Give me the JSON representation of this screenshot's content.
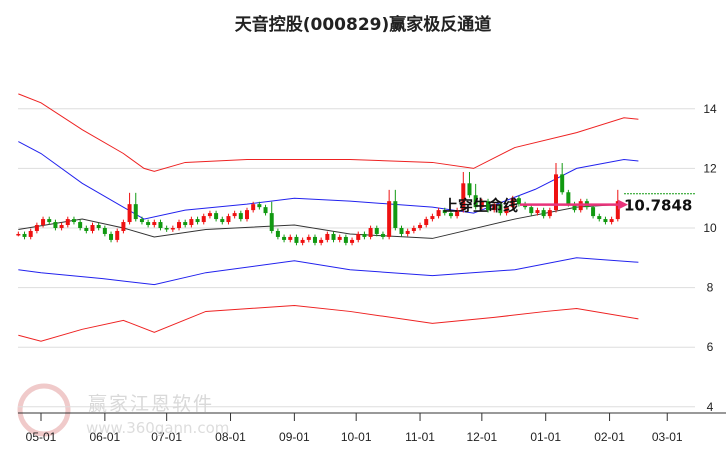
{
  "chart_data": {
    "type": "line",
    "title": "天音控股(000829)赢家极反通道",
    "ylim": [
      4,
      15
    ],
    "y_ticks": [
      4,
      6,
      8,
      10,
      12,
      14
    ],
    "x_ticks": [
      {
        "label": "05-01",
        "day": 0
      },
      {
        "label": "06-01",
        "day": 31
      },
      {
        "label": "07-01",
        "day": 61
      },
      {
        "label": "08-01",
        "day": 92
      },
      {
        "label": "09-01",
        "day": 123
      },
      {
        "label": "10-01",
        "day": 153
      },
      {
        "label": "11-01",
        "day": 184
      },
      {
        "label": "12-01",
        "day": 214
      },
      {
        "label": "01-01",
        "day": 245
      },
      {
        "label": "02-01",
        "day": 276
      },
      {
        "label": "03-01",
        "day": 304
      }
    ],
    "series": [
      {
        "name": "upper-outer",
        "color": "#ee2222",
        "points": [
          [
            -11,
            14.5
          ],
          [
            0,
            14.2
          ],
          [
            20,
            13.3
          ],
          [
            40,
            12.5
          ],
          [
            50,
            12.0
          ],
          [
            55,
            11.9
          ],
          [
            70,
            12.2
          ],
          [
            100,
            12.3
          ],
          [
            150,
            12.3
          ],
          [
            190,
            12.2
          ],
          [
            210,
            12.0
          ],
          [
            230,
            12.7
          ],
          [
            260,
            13.2
          ],
          [
            283,
            13.7
          ],
          [
            290,
            13.65
          ]
        ]
      },
      {
        "name": "upper-inner",
        "color": "#2222ee",
        "points": [
          [
            -11,
            12.9
          ],
          [
            0,
            12.5
          ],
          [
            20,
            11.5
          ],
          [
            40,
            10.7
          ],
          [
            50,
            10.3
          ],
          [
            70,
            10.6
          ],
          [
            100,
            10.8
          ],
          [
            123,
            11.0
          ],
          [
            150,
            10.9
          ],
          [
            190,
            10.7
          ],
          [
            210,
            10.5
          ],
          [
            240,
            11.3
          ],
          [
            260,
            12.0
          ],
          [
            283,
            12.3
          ],
          [
            290,
            12.25
          ]
        ]
      },
      {
        "name": "lifeline",
        "color": "#333333",
        "points": [
          [
            -11,
            9.95
          ],
          [
            20,
            10.3
          ],
          [
            40,
            10.0
          ],
          [
            55,
            9.7
          ],
          [
            80,
            9.95
          ],
          [
            123,
            10.1
          ],
          [
            150,
            9.8
          ],
          [
            190,
            9.65
          ],
          [
            230,
            10.3
          ],
          [
            260,
            10.7
          ],
          [
            283,
            10.8
          ]
        ]
      },
      {
        "name": "lower-inner",
        "color": "#2222ee",
        "points": [
          [
            -11,
            8.6
          ],
          [
            0,
            8.5
          ],
          [
            30,
            8.3
          ],
          [
            55,
            8.1
          ],
          [
            80,
            8.5
          ],
          [
            123,
            8.9
          ],
          [
            150,
            8.6
          ],
          [
            190,
            8.4
          ],
          [
            230,
            8.6
          ],
          [
            260,
            9.0
          ],
          [
            290,
            8.85
          ]
        ]
      },
      {
        "name": "lower-outer",
        "color": "#ee2222",
        "points": [
          [
            -11,
            6.4
          ],
          [
            0,
            6.2
          ],
          [
            20,
            6.6
          ],
          [
            40,
            6.9
          ],
          [
            55,
            6.5
          ],
          [
            80,
            7.2
          ],
          [
            123,
            7.4
          ],
          [
            150,
            7.2
          ],
          [
            190,
            6.8
          ],
          [
            220,
            7.0
          ],
          [
            245,
            7.2
          ],
          [
            260,
            7.3
          ],
          [
            290,
            6.95
          ]
        ]
      }
    ],
    "candles": {
      "start_day": -11,
      "step_days": 3,
      "closes": [
        9.8,
        9.7,
        9.9,
        10.1,
        10.3,
        10.2,
        10.0,
        10.1,
        10.3,
        10.2,
        10.0,
        9.9,
        10.1,
        10.0,
        9.8,
        9.6,
        9.9,
        10.2,
        10.8,
        10.3,
        10.2,
        10.1,
        10.2,
        10.0,
        9.95,
        10.0,
        10.2,
        10.1,
        10.3,
        10.2,
        10.4,
        10.5,
        10.3,
        10.2,
        10.4,
        10.5,
        10.3,
        10.6,
        10.8,
        10.7,
        10.5,
        9.9,
        9.7,
        9.6,
        9.7,
        9.5,
        9.6,
        9.7,
        9.5,
        9.6,
        9.8,
        9.6,
        9.7,
        9.5,
        9.6,
        9.8,
        9.7,
        10.0,
        9.8,
        9.7,
        10.9,
        10.0,
        9.8,
        9.9,
        10.0,
        10.1,
        10.3,
        10.4,
        10.6,
        10.5,
        10.4,
        10.6,
        11.5,
        11.1,
        10.7,
        10.9,
        10.6,
        10.8,
        10.5,
        10.7,
        11.0,
        10.8,
        10.7,
        10.5,
        10.6,
        10.4,
        10.6,
        11.8,
        11.2,
        10.8,
        10.6,
        10.9,
        10.7,
        10.4,
        10.3,
        10.2,
        10.3,
        10.9
      ],
      "up_color": "#ee1111",
      "down_color": "#119911"
    },
    "annotations": {
      "signal": "上穿生命线",
      "value_label": "10.7848",
      "value": 10.7848,
      "target": 11.15
    }
  },
  "watermark": {
    "name": "赢家江恩软件",
    "url": "www.360gann.com",
    "seal": "江赢恩家"
  }
}
